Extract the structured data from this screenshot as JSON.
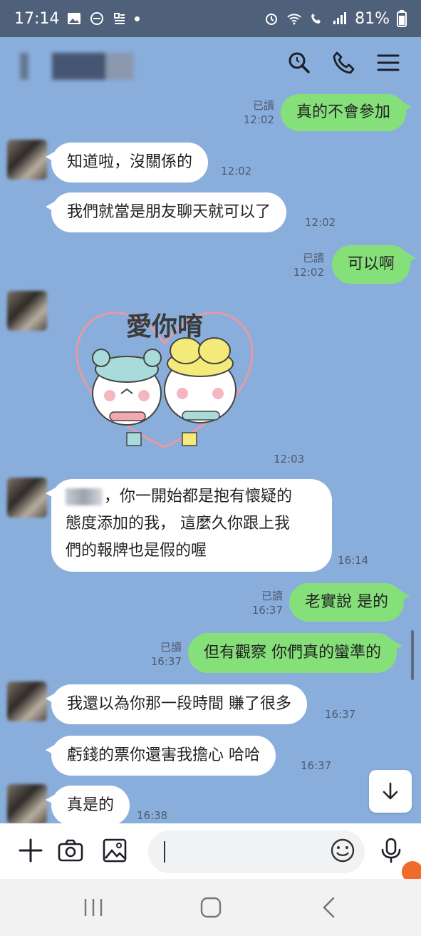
{
  "status": {
    "time": "17:14",
    "battery": "81%"
  },
  "messages": [
    {
      "dir": "out",
      "text": "真的不會參加",
      "read": "已讀",
      "time": "12:02"
    },
    {
      "dir": "in",
      "text": "知道啦，沒關係的",
      "time": "12:02"
    },
    {
      "dir": "in",
      "text": "我們就當是朋友聊天就可以了",
      "time": "12:02"
    },
    {
      "dir": "out",
      "text": "可以啊",
      "read": "已讀",
      "time": "12:02"
    },
    {
      "dir": "in",
      "sticker_text": "愛你唷",
      "time": "12:03"
    },
    {
      "dir": "in",
      "lines": [
        "，你一開始都是抱有懷疑的",
        "態度添加的我， 這麼久你跟上我",
        "們的報牌也是假的喔"
      ],
      "time": "16:14"
    },
    {
      "dir": "out",
      "text": "老實說  是的",
      "read": "已讀",
      "time": "16:37"
    },
    {
      "dir": "out",
      "text": "但有觀察  你們真的蠻準的",
      "read": "已讀",
      "time": "16:37"
    },
    {
      "dir": "in",
      "text": "我還以為你那一段時間 賺了很多",
      "time": "16:37"
    },
    {
      "dir": "in",
      "text": "虧錢的票你還害我擔心 哈哈",
      "time": "16:37"
    },
    {
      "dir": "in",
      "text": "真是的",
      "time": "16:38"
    }
  ],
  "icons": {
    "search": "search-icon",
    "call": "phone-icon",
    "menu": "menu-icon",
    "add": "plus-icon",
    "camera": "camera-icon",
    "gallery": "image-icon",
    "emoji": "emoji-icon",
    "mic": "mic-icon",
    "scroll": "arrow-down-icon"
  },
  "colors": {
    "chat_bg": "#8aaedc",
    "out_bubble": "#86e07a",
    "in_bubble": "#ffffff"
  }
}
